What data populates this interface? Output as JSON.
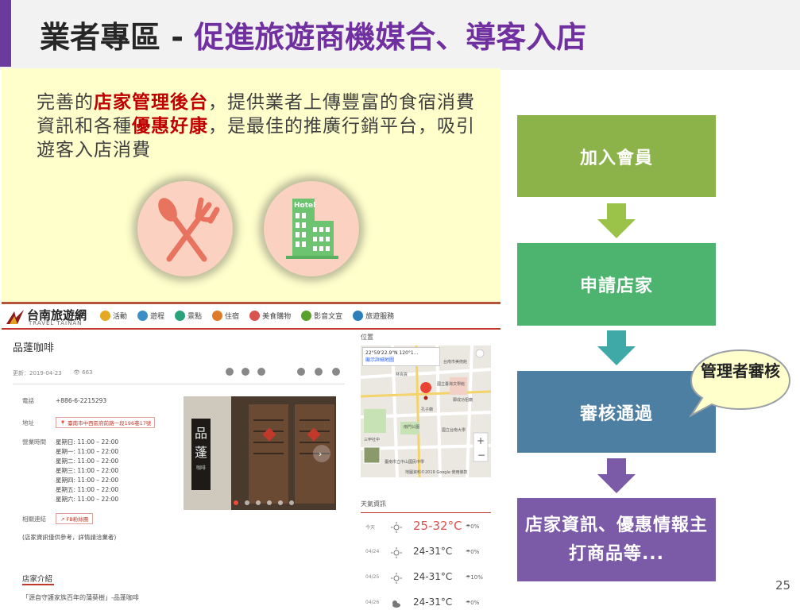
{
  "slide": {
    "title_main": "業者專區",
    "title_sep": " - ",
    "title_sub": "促進旅遊商機媒合、導客入店",
    "intro": {
      "p1": "完善的",
      "h1": "店家管理後台",
      "p2": "，提供業者上傳豐富的食宿消費資訊和各種",
      "h2": "優惠好康",
      "p3": "，是最佳的推廣行銷平台，吸引遊客入店消費"
    },
    "flow": [
      "加入會員",
      "申請店家",
      "審核通過",
      "店家資訊、優惠情報主打商品等..."
    ],
    "bubble": "管理者審核",
    "page_number": "25",
    "colors": {
      "title_accent": "#6a3a9c",
      "title_sub": "#7030a0",
      "highlight": "#c00000",
      "step1": "#8cb34a",
      "step2": "#4cb46e",
      "step3": "#4c7fa2",
      "step4": "#7b5ba8"
    },
    "icons": [
      "fork-knife-icon",
      "hotel-icon"
    ]
  },
  "site": {
    "logo_title": "台南旅遊網",
    "logo_sub": "TRAVEL TAINAN",
    "nav": [
      {
        "label": "活動",
        "color": "#e5a823"
      },
      {
        "label": "遊程",
        "color": "#3a8fc7"
      },
      {
        "label": "景點",
        "color": "#2aa37a"
      },
      {
        "label": "住宿",
        "color": "#e07b2a"
      },
      {
        "label": "美食購物",
        "color": "#d9534f"
      },
      {
        "label": "影音文宣",
        "color": "#5aa02c"
      },
      {
        "label": "旅遊服務",
        "color": "#2a7fb8"
      }
    ],
    "shop_name": "品蓬咖啡",
    "updated": "更新：2019-04-23",
    "views": "663",
    "phone_label": "電話",
    "phone": "+886-6-2215293",
    "address_label": "地址",
    "address": "臺南市中西區府前路一段196巷17號",
    "hours_label": "營業時間",
    "hours": [
      "星期日: 11:00 – 22:00",
      "星期一: 11:00 – 22:00",
      "星期二: 11:00 – 22:00",
      "星期三: 11:00 – 22:00",
      "星期四: 11:00 – 22:00",
      "星期五: 11:00 – 22:00",
      "星期六: 11:00 – 22:00"
    ],
    "links_label": "相關連結",
    "fb": "FB粉絲團",
    "disclaimer": "(店家資訊僅供參考，詳情請洽業者)",
    "intro_heading": "店家介紹",
    "intro_quote": "「源自守護家族百年的蒲葵樹」-品蓬咖啡",
    "photo_text_1": "品",
    "photo_text_2": "蓬",
    "photo_text_3": "咖啡",
    "location_heading": "位置",
    "map_coord": "22°59'22.9\"N 120°1...",
    "map_view": "顯示詳細地圖",
    "map_copyright": "地圖資料©2019 Google   使用條款",
    "map_places": [
      "林百貨",
      "國立臺灣文學館",
      "台南市美術館",
      "南門公園",
      "國立台南大學",
      "三甲社中",
      "臺南市立中山國民中學",
      "孔子廟",
      "鄭成功祖廟"
    ],
    "weather_heading": "天氣資訊",
    "weather": [
      {
        "date": "今天",
        "temp": "25-32°C",
        "rain": "0%"
      },
      {
        "date": "04/24",
        "temp": "24-31°C",
        "rain": "0%"
      },
      {
        "date": "04/25",
        "temp": "24-31°C",
        "rain": "10%"
      },
      {
        "date": "04/26",
        "temp": "24-31°C",
        "rain": "0%"
      }
    ]
  }
}
